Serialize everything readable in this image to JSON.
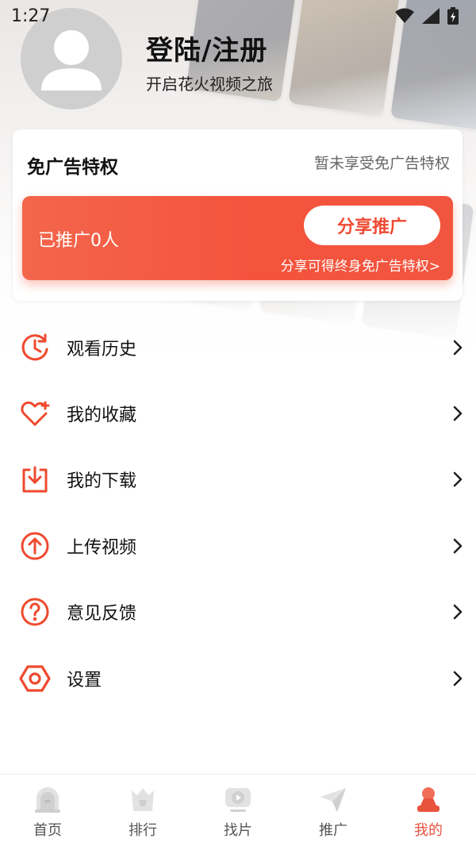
{
  "status_bar": {
    "time": "1:27"
  },
  "profile": {
    "title": "登陆/注册",
    "subtitle": "开启花火视频之旅"
  },
  "privilege": {
    "title": "免广告特权",
    "status": "暂未享受免广告特权",
    "promo_count": "已推广0人",
    "share_label": "分享推广",
    "hint": "分享可得终身免广告特权>"
  },
  "menu": [
    {
      "label": "观看历史",
      "icon": "history-icon"
    },
    {
      "label": "我的收藏",
      "icon": "favorite-heart-icon"
    },
    {
      "label": "我的下载",
      "icon": "download-icon"
    },
    {
      "label": "上传视频",
      "icon": "upload-icon"
    },
    {
      "label": "意见反馈",
      "icon": "help-question-icon"
    },
    {
      "label": "设置",
      "icon": "settings-hexagon-icon"
    }
  ],
  "bottom_nav": [
    {
      "label": "首页",
      "icon": "home-icon",
      "active": false
    },
    {
      "label": "排行",
      "icon": "ranking-crown-icon",
      "active": false
    },
    {
      "label": "找片",
      "icon": "find-video-icon",
      "active": false
    },
    {
      "label": "推广",
      "icon": "promote-send-icon",
      "active": false
    },
    {
      "label": "我的",
      "icon": "profile-icon",
      "active": true
    }
  ],
  "colors": {
    "accent": "#e9533e",
    "promo_gradient_start": "#f3664c",
    "promo_gradient_end": "#f2553f",
    "inactive_nav": "#d9d9d9"
  }
}
